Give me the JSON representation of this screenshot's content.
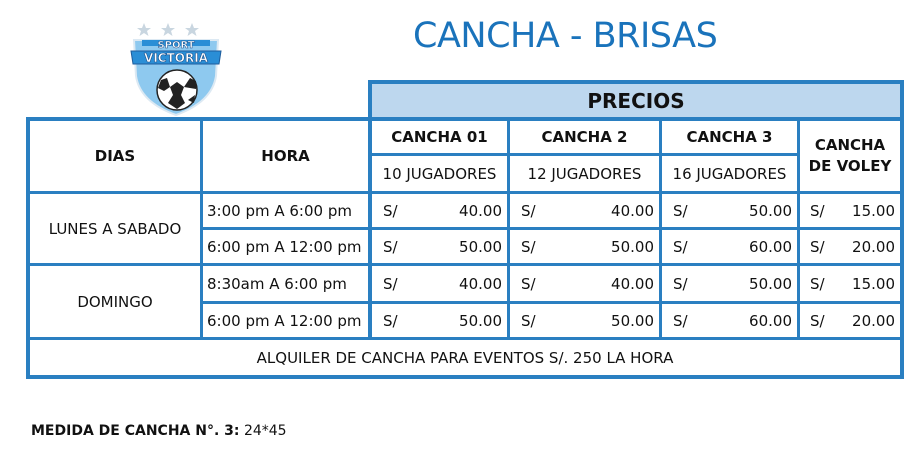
{
  "logo": {
    "top_text": "SPORT",
    "main_text": "VICTORIA",
    "icon": "soccer-ball-shield-icon"
  },
  "title": "CANCHA - BRISAS",
  "table": {
    "precios_header": "PRECIOS",
    "col_dias": "DIAS",
    "col_hora": "HORA",
    "canchas": [
      {
        "name": "CANCHA 01",
        "players": "10 JUGADORES"
      },
      {
        "name": "CANCHA 2",
        "players": "12 JUGADORES"
      },
      {
        "name": "CANCHA 3",
        "players": "16 JUGADORES"
      }
    ],
    "voley_line1": "CANCHA",
    "voley_line2": "DE VOLEY",
    "currency": "S/",
    "groups": [
      {
        "days": "LUNES A SABADO",
        "rows": [
          {
            "hora": "3:00 pm A 6:00 pm",
            "prices": [
              "40.00",
              "40.00",
              "50.00",
              "15.00"
            ]
          },
          {
            "hora": "6:00 pm A 12:00 pm",
            "prices": [
              "50.00",
              "50.00",
              "60.00",
              "20.00"
            ]
          }
        ]
      },
      {
        "days": "DOMINGO",
        "rows": [
          {
            "hora": "8:30am A 6:00 pm",
            "prices": [
              "40.00",
              "40.00",
              "50.00",
              "15.00"
            ]
          },
          {
            "hora": "6:00 pm A 12:00 pm",
            "prices": [
              "50.00",
              "50.00",
              "60.00",
              "20.00"
            ]
          }
        ]
      }
    ],
    "footer_row": "ALQUILER DE CANCHA PARA EVENTOS S/. 250 LA HORA"
  },
  "measure": {
    "label": "MEDIDA DE CANCHA N°. 3:",
    "value": "24*45"
  },
  "colors": {
    "border": "#2a7fc1",
    "header_fill": "#bdd7ee",
    "title": "#1a73bb"
  }
}
